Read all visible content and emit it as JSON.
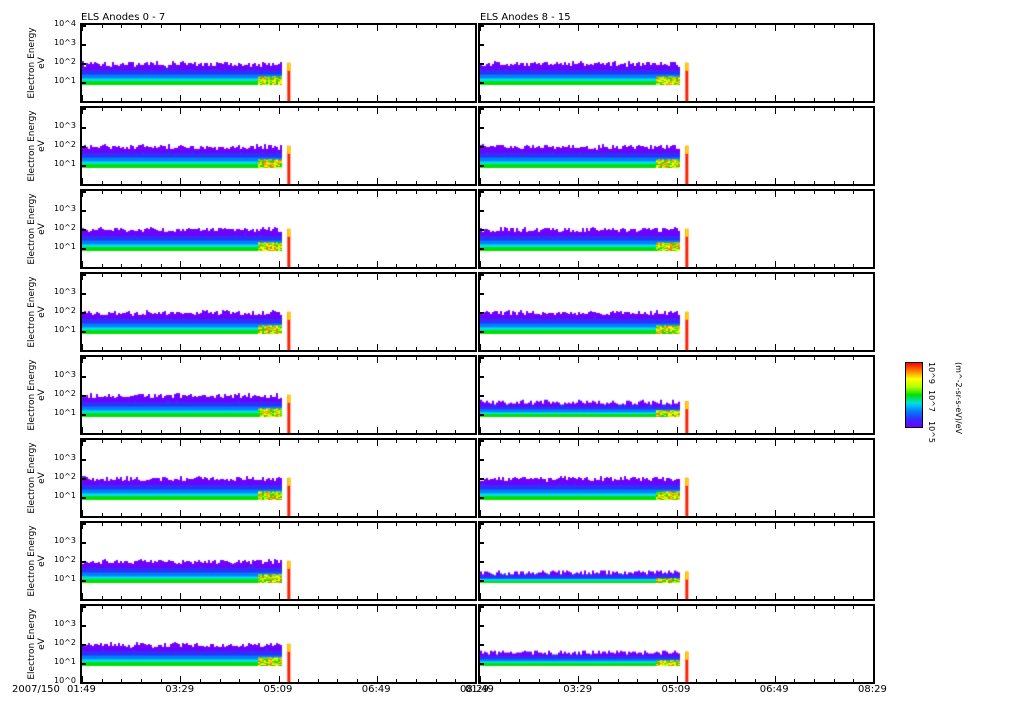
{
  "chart_data": {
    "type": "heatmap",
    "titles": [
      "ELS Anodes 0 - 7",
      "ELS Anodes 8 - 15"
    ],
    "ylabel": "Electron Energy",
    "yunit": "eV",
    "y_scale": "log",
    "ylim": [
      1,
      10000
    ],
    "y_tick_labels": [
      "10^0",
      "10^1",
      "10^2",
      "10^3",
      "10^4"
    ],
    "x_date_label": "2007/150",
    "x_tick_labels": [
      "01:49",
      "03:29",
      "05:09",
      "06:49",
      "08:29"
    ],
    "x_range_minutes": [
      109,
      509
    ],
    "data_end_minutes": 318,
    "columns": [
      {
        "title_index": 0,
        "panels": [
          {
            "anode": 0,
            "max_energy_eV": 130
          },
          {
            "anode": 1,
            "max_energy_eV": 130
          },
          {
            "anode": 2,
            "max_energy_eV": 130
          },
          {
            "anode": 3,
            "max_energy_eV": 130
          },
          {
            "anode": 4,
            "max_energy_eV": 130
          },
          {
            "anode": 5,
            "max_energy_eV": 130
          },
          {
            "anode": 6,
            "max_energy_eV": 130
          },
          {
            "anode": 7,
            "max_energy_eV": 130
          }
        ]
      },
      {
        "title_index": 1,
        "panels": [
          {
            "anode": 8,
            "max_energy_eV": 130
          },
          {
            "anode": 9,
            "max_energy_eV": 130
          },
          {
            "anode": 10,
            "max_energy_eV": 130
          },
          {
            "anode": 11,
            "max_energy_eV": 130
          },
          {
            "anode": 12,
            "max_energy_eV": 60
          },
          {
            "anode": 13,
            "max_energy_eV": 130
          },
          {
            "anode": 14,
            "max_energy_eV": 35
          },
          {
            "anode": 15,
            "max_energy_eV": 50
          }
        ]
      }
    ],
    "colorbar": {
      "label": "(m^-2-sr-s-eV)/eV",
      "tick_labels": [
        "10^5",
        "10^7",
        "10^9"
      ],
      "colors": [
        "#7000ff",
        "#3030ff",
        "#0080ff",
        "#00e0e0",
        "#00e000",
        "#b0ff00",
        "#ffff00",
        "#ff8000",
        "#ff0000"
      ]
    }
  }
}
